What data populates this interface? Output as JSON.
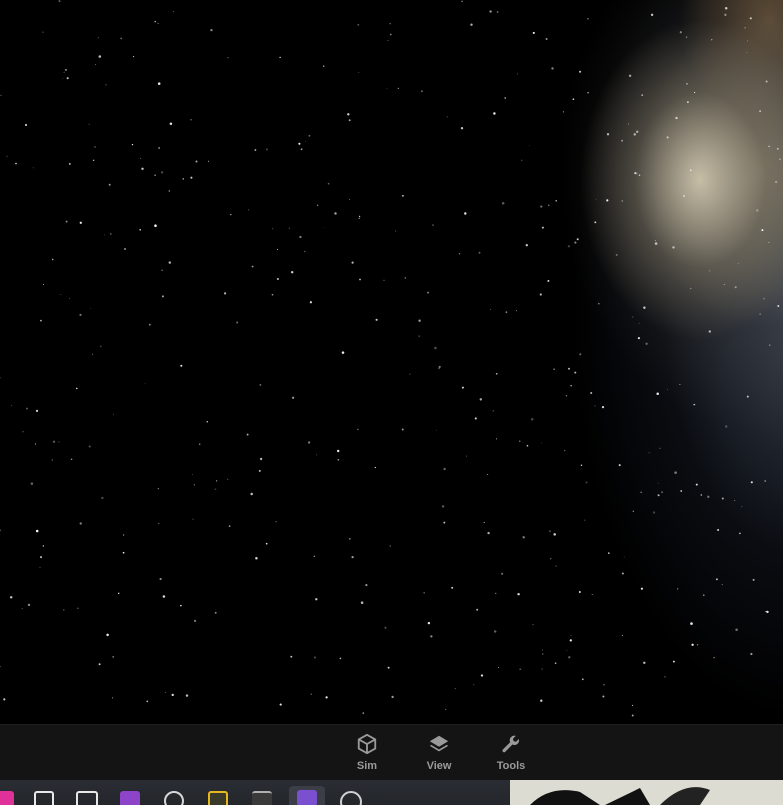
{
  "toolbar": {
    "items": [
      {
        "label": "Sim",
        "icon": "cube-icon"
      },
      {
        "label": "View",
        "icon": "layers-icon"
      },
      {
        "label": "Tools",
        "icon": "wrench-icon"
      }
    ]
  },
  "taskbar": {
    "apps": [
      {
        "icon": "pink-app-icon",
        "color": "#e0309a"
      },
      {
        "icon": "document-app-icon",
        "color": "#e8e8e8"
      },
      {
        "icon": "window-app-icon",
        "color": "#e8e8e8"
      },
      {
        "icon": "onenote-icon",
        "color": "#8e44c8"
      },
      {
        "icon": "openai-icon",
        "color": "#d8d8d8"
      },
      {
        "icon": "yellow-app-icon",
        "color": "#e6b820"
      },
      {
        "icon": "terminal-icon",
        "color": "#b0b0b0"
      },
      {
        "icon": "active-app-icon",
        "color": "#7a4fd0"
      },
      {
        "icon": "globe-app-icon",
        "color": "#d0d0d0"
      }
    ]
  },
  "colors": {
    "toolbar_bg": "#141414",
    "toolbar_icon": "#9a9a9a",
    "taskbar_bg": "#2a2d33"
  }
}
